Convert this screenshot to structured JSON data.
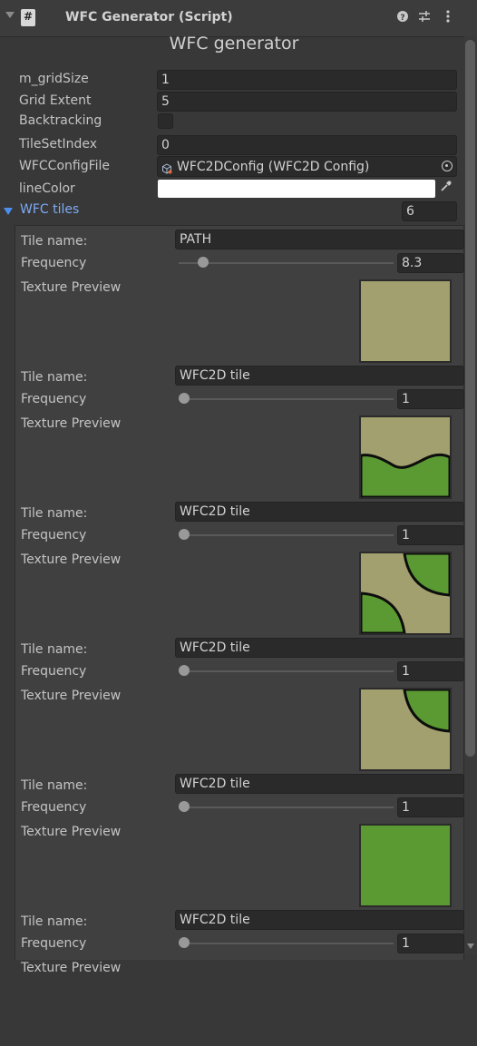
{
  "header": {
    "title": "WFC Generator (Script)",
    "script_icon": "#",
    "icons": [
      "help-icon",
      "presets-icon",
      "kebab-menu-icon"
    ]
  },
  "page_title": "WFC generator",
  "fields": {
    "grid_size": {
      "label": "m_gridSize",
      "value": "1"
    },
    "grid_extent": {
      "label": "Grid Extent",
      "value": "5"
    },
    "backtracking": {
      "label": "Backtracking",
      "checked": false
    },
    "tileset_index": {
      "label": "TileSetIndex",
      "value": "0"
    },
    "config_file": {
      "label": "WFCConfigFile",
      "value": "WFC2DConfig (WFC2D Config)"
    },
    "line_color": {
      "label": "lineColor",
      "color": "#ffffff"
    }
  },
  "tiles_foldout": {
    "label": "WFC tiles",
    "count": "6"
  },
  "tile_labels": {
    "name": "Tile name:",
    "frequency": "Frequency",
    "preview": "Texture Preview"
  },
  "tiles": [
    {
      "name": "PATH",
      "frequency": "8.3",
      "slider_fraction": 0.09,
      "texture": "solid-path"
    },
    {
      "name": "WFC2D tile",
      "frequency": "1",
      "slider_fraction": 0.0,
      "texture": "wave-border"
    },
    {
      "name": "WFC2D tile",
      "frequency": "1",
      "slider_fraction": 0.0,
      "texture": "two-corners"
    },
    {
      "name": "WFC2D tile",
      "frequency": "1",
      "slider_fraction": 0.0,
      "texture": "one-corner"
    },
    {
      "name": "WFC2D tile",
      "frequency": "1",
      "slider_fraction": 0.0,
      "texture": "solid-grass"
    },
    {
      "name": "WFC2D tile",
      "frequency": "1",
      "slider_fraction": 0.0,
      "texture": "none"
    }
  ],
  "colors": {
    "path": "#a2a06e",
    "grass": "#5b9a33",
    "border": "#0d0d0d",
    "accent": "#7daaf6"
  }
}
